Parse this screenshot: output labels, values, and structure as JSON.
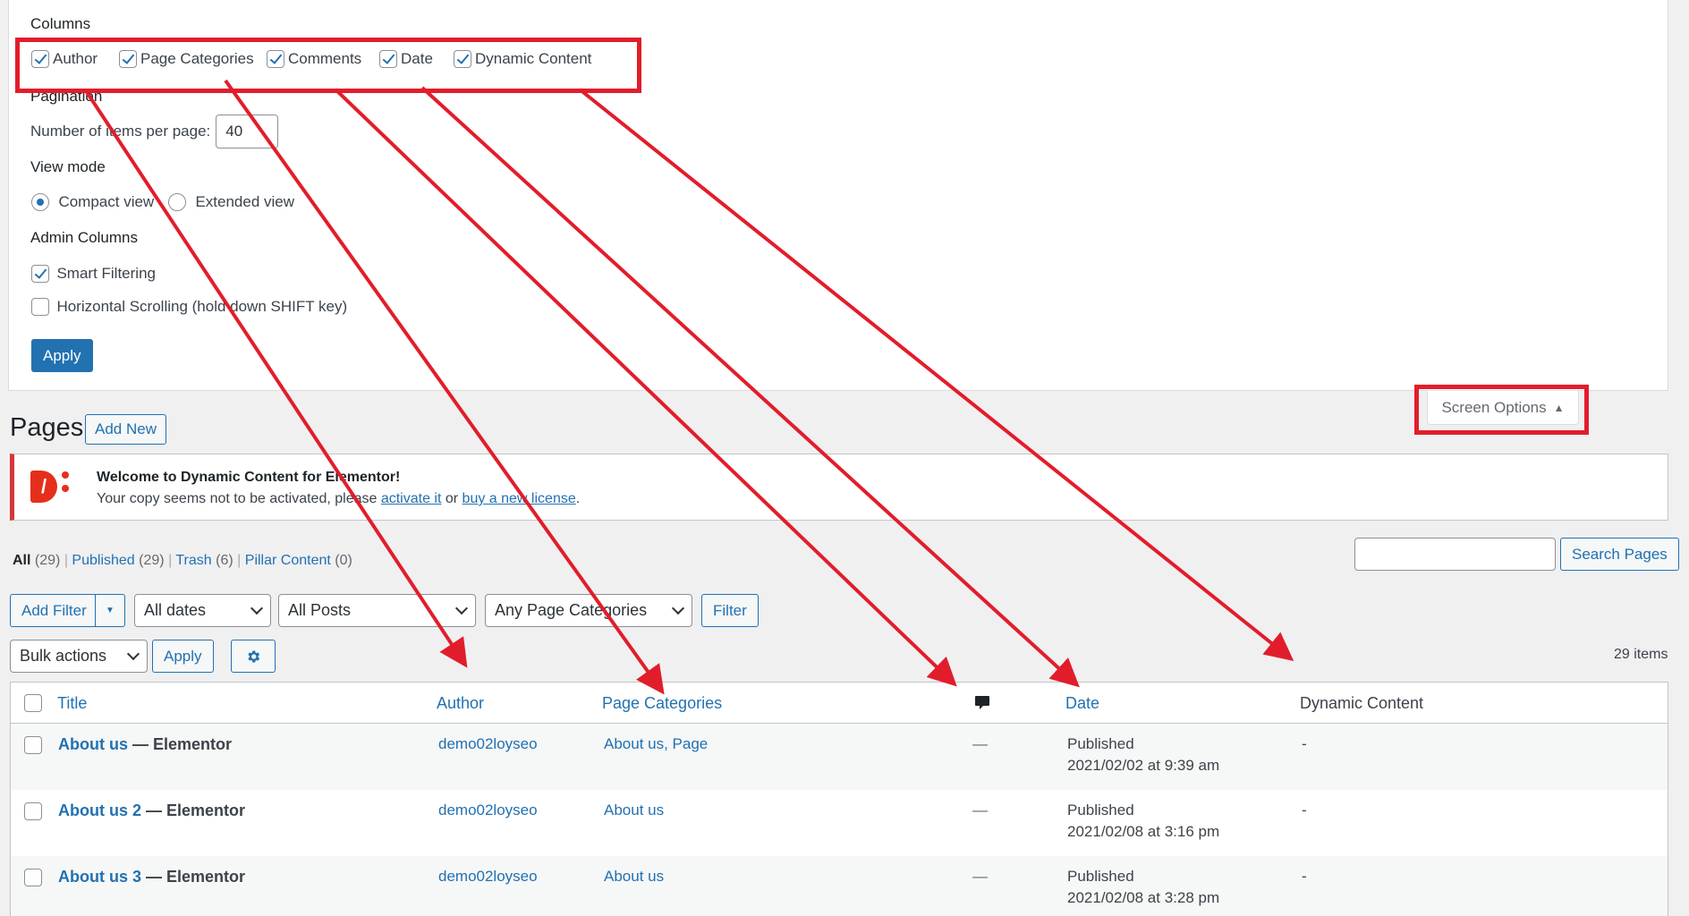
{
  "screen_options": {
    "columns_legend": "Columns",
    "columns": [
      {
        "label": "Author",
        "checked": true
      },
      {
        "label": "Page Categories",
        "checked": true
      },
      {
        "label": "Comments",
        "checked": true
      },
      {
        "label": "Date",
        "checked": true
      },
      {
        "label": "Dynamic Content",
        "checked": true
      }
    ],
    "pagination_legend": "Pagination",
    "items_per_page_label": "Number of items per page:",
    "items_per_page_value": "40",
    "view_mode_legend": "View mode",
    "view_modes": [
      {
        "label": "Compact view",
        "checked": true
      },
      {
        "label": "Extended view",
        "checked": false
      }
    ],
    "admin_columns_legend": "Admin Columns",
    "admin_columns": [
      {
        "label": "Smart Filtering",
        "checked": true
      },
      {
        "label": "Horizontal Scrolling (hold down SHIFT key)",
        "checked": false
      }
    ],
    "apply_label": "Apply"
  },
  "screen_options_tab": {
    "label": "Screen Options",
    "arrow": "▲"
  },
  "header": {
    "title": "Pages",
    "add_new_label": "Add New"
  },
  "notice": {
    "title": "Welcome to Dynamic Content for Elementor!",
    "text_before": "Your copy seems not to be activated, please ",
    "link1": "activate it",
    "text_middle": " or ",
    "link2": "buy a new license",
    "text_after": ".",
    "logo_text": "/"
  },
  "subsubsub": [
    {
      "label": "All",
      "count": "(29)",
      "current": true
    },
    {
      "label": "Published",
      "count": "(29)",
      "current": false
    },
    {
      "label": "Trash",
      "count": "(6)",
      "current": false
    },
    {
      "label": "Pillar Content",
      "count": "(0)",
      "current": false
    }
  ],
  "search": {
    "button_label": "Search Pages",
    "value": ""
  },
  "filters": {
    "add_filter_label": "Add Filter",
    "dates": "All dates",
    "posts": "All Posts",
    "categories": "Any Page Categories",
    "filter_label": "Filter"
  },
  "bulk": {
    "selected": "Bulk actions",
    "apply_label": "Apply",
    "items_count": "29 items"
  },
  "table": {
    "headers": {
      "title": "Title",
      "author": "Author",
      "categories": "Page Categories",
      "date": "Date",
      "dynamic": "Dynamic Content"
    },
    "rows": [
      {
        "title": "About us",
        "suffix": " — Elementor",
        "author": "demo02loyseo",
        "categories": "About us, Page",
        "comments": "—",
        "status": "Published",
        "date": "2021/02/02 at 9:39 am",
        "dynamic": "-"
      },
      {
        "title": "About us 2",
        "suffix": " — Elementor",
        "author": "demo02loyseo",
        "categories": "About us",
        "comments": "—",
        "status": "Published",
        "date": "2021/02/08 at 3:16 pm",
        "dynamic": "-"
      },
      {
        "title": "About us 3",
        "suffix": " — Elementor",
        "author": "demo02loyseo",
        "categories": "About us",
        "comments": "—",
        "status": "Published",
        "date": "2021/02/08 at 3:28 pm",
        "dynamic": "-"
      }
    ]
  },
  "colors": {
    "accent": "#2271b1",
    "annotation": "#e21d2b",
    "logo": "#e52f1b"
  }
}
